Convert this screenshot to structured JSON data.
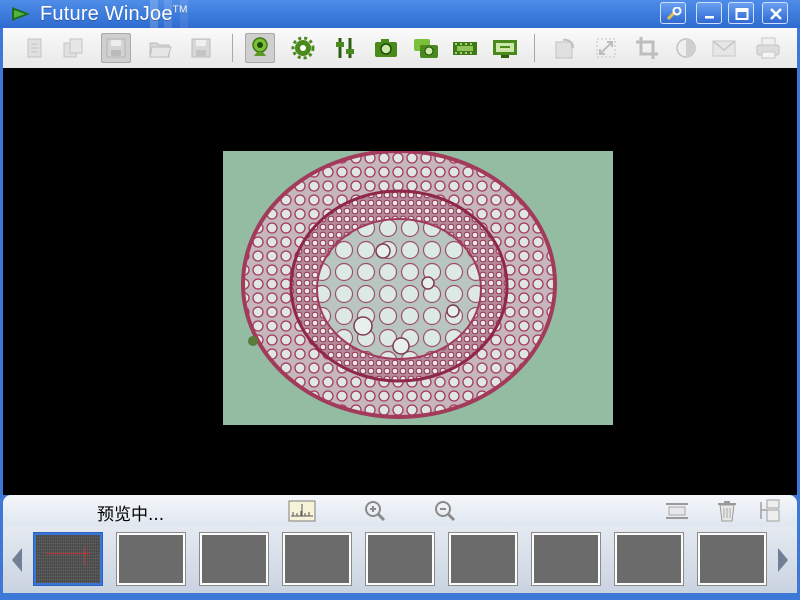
{
  "app": {
    "title": "Future WinJoe",
    "trademark": "TM"
  },
  "window_controls": [
    "tools-icon",
    "minimize-icon",
    "maximize-icon",
    "close-icon"
  ],
  "toolbar": {
    "buttons": [
      "new-icon",
      "copy-icon",
      "save-icon",
      "open-folder-icon",
      "save-as-icon",
      "camera-preview-icon",
      "settings-icon",
      "adjust-icon",
      "capture-icon",
      "burst-capture-icon",
      "video-icon",
      "display-icon",
      "rotate-icon",
      "resize-icon",
      "crop-icon",
      "contrast-icon",
      "email-icon",
      "print-icon"
    ]
  },
  "status": {
    "text": "预览中..."
  },
  "bottom_tools": [
    "calibrate-icon",
    "zoom-in-icon",
    "zoom-out-icon",
    "fit-icon",
    "delete-icon",
    "export-icon"
  ],
  "thumbnails": {
    "count": 9,
    "selected_index": 0
  },
  "colors": {
    "titlebar": "#2d6bd0",
    "toolbar_icon_green": "#4a8a1c",
    "toolbar_icon_gray": "#c8c8c8",
    "specimen_background": "#8fb89e",
    "stain_red": "#a23a5a"
  }
}
